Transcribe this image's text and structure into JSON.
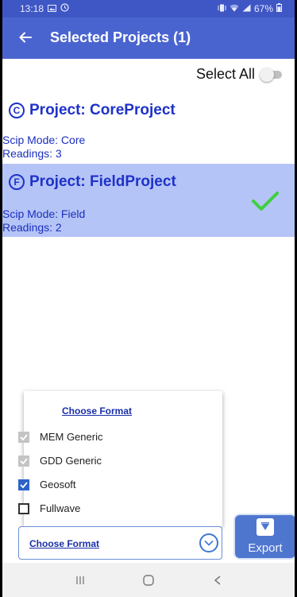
{
  "status_bar": {
    "time": "13:18",
    "battery": "67%"
  },
  "app_bar": {
    "title": "Selected Projects (1)"
  },
  "select_all": {
    "label": "Select All",
    "enabled": false
  },
  "projects": [
    {
      "badge": "C",
      "title": "Project: CoreProject",
      "mode": "Scip Mode: Core",
      "readings": "Readings: 3",
      "selected": false
    },
    {
      "badge": "F",
      "title": "Project: FieldProject",
      "mode": "Scip Mode: Field",
      "readings": "Readings: 2",
      "selected": true
    }
  ],
  "format_popup": {
    "header": "Choose Format",
    "options": [
      {
        "label": "MEM Generic",
        "state": "disabled-checked"
      },
      {
        "label": "GDD Generic",
        "state": "disabled-checked"
      },
      {
        "label": "Geosoft",
        "state": "checked"
      },
      {
        "label": "Fullwave",
        "state": "unchecked"
      }
    ]
  },
  "format_picker": {
    "label": "Choose Format"
  },
  "export_button": {
    "label": "Export"
  },
  "colors": {
    "app_bar": "#4a64cf",
    "selected_row": "#b5c4f6",
    "project_title": "#1e32c8",
    "check": "#3fcf3f"
  }
}
